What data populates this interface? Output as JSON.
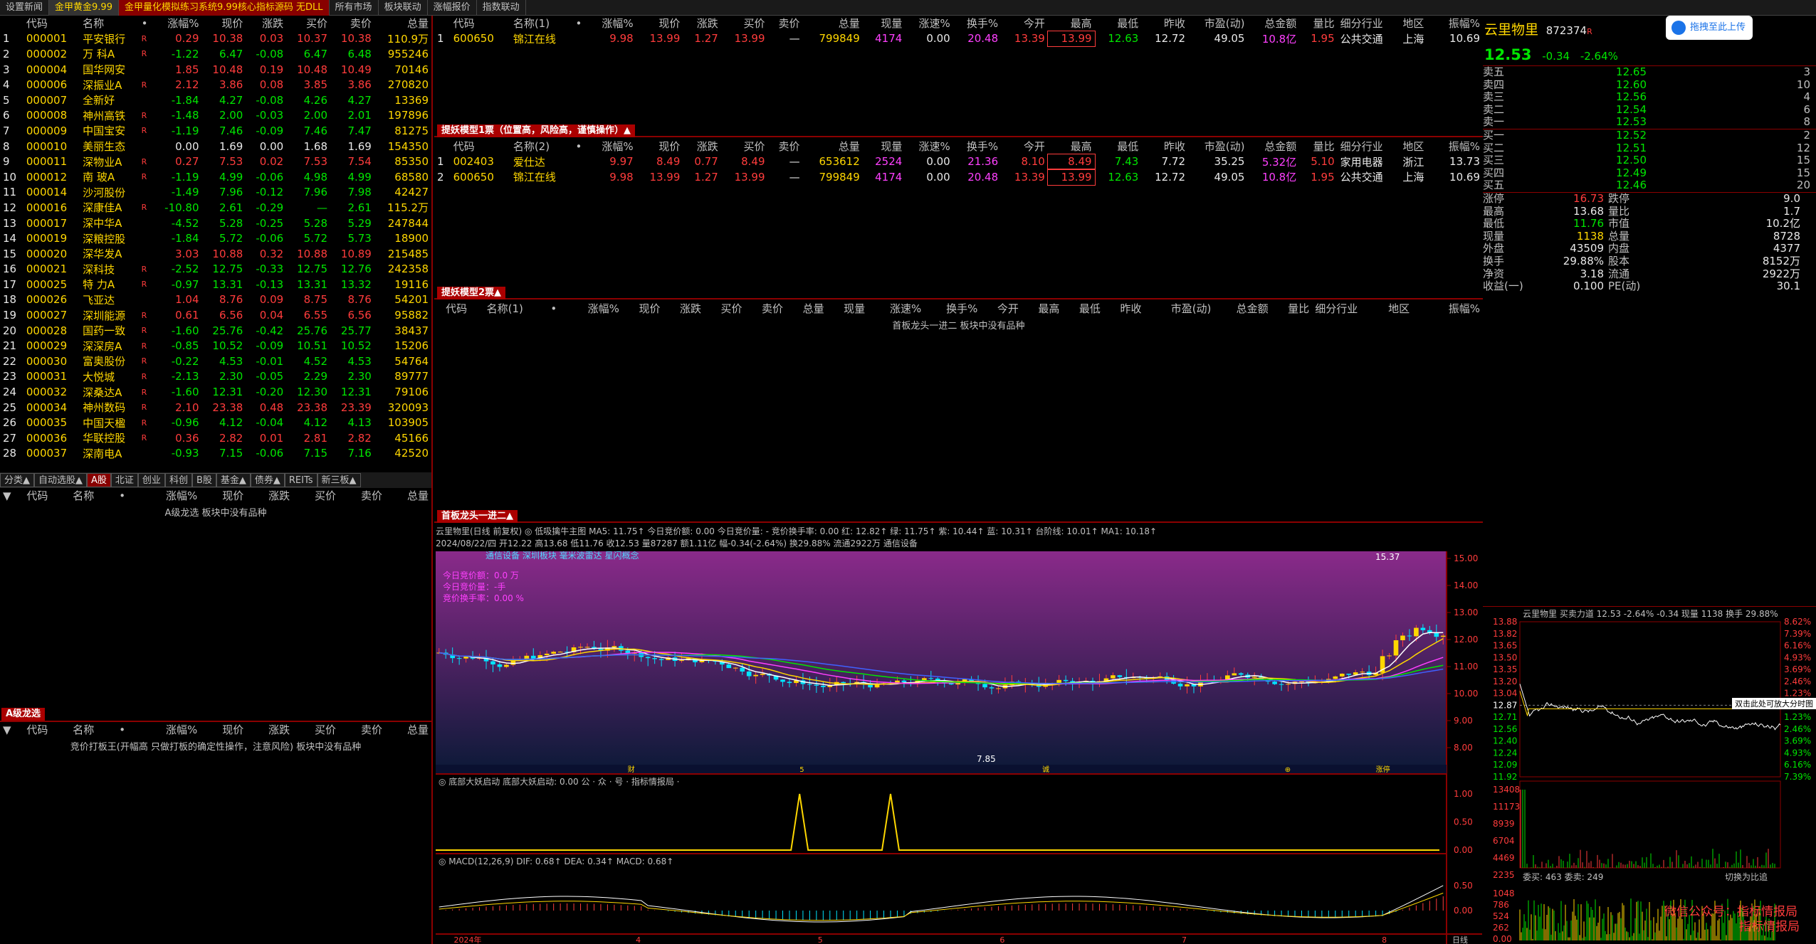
{
  "top_tabs": [
    "设置新闻",
    "金甲黄金9.99",
    "金甲量化模拟练习系统9.99核心指标源码 无DLL",
    "所有市场",
    "板块联动",
    "涨幅报价",
    "指数联动"
  ],
  "left_headers": [
    "",
    "代码",
    "名称",
    "•",
    "涨幅%",
    "现价",
    "涨跌",
    "买价",
    "卖价",
    "总量"
  ],
  "left_rows": [
    [
      "1",
      "000001",
      "平安银行",
      "R",
      "0.29",
      "10.38",
      "0.03",
      "10.37",
      "10.38",
      "110.9万"
    ],
    [
      "2",
      "000002",
      "万 科A",
      "R",
      "-1.22",
      "6.47",
      "-0.08",
      "6.47",
      "6.48",
      "955246"
    ],
    [
      "3",
      "000004",
      "国华网安",
      "",
      "1.85",
      "10.48",
      "0.19",
      "10.48",
      "10.49",
      "70146"
    ],
    [
      "4",
      "000006",
      "深振业A",
      "R",
      "2.12",
      "3.86",
      "0.08",
      "3.85",
      "3.86",
      "270820"
    ],
    [
      "5",
      "000007",
      "全新好",
      "",
      "-1.84",
      "4.27",
      "-0.08",
      "4.26",
      "4.27",
      "13369"
    ],
    [
      "6",
      "000008",
      "神州高铁",
      "R",
      "-1.48",
      "2.00",
      "-0.03",
      "2.00",
      "2.01",
      "197896"
    ],
    [
      "7",
      "000009",
      "中国宝安",
      "R",
      "-1.19",
      "7.46",
      "-0.09",
      "7.46",
      "7.47",
      "81275"
    ],
    [
      "8",
      "000010",
      "美丽生态",
      "",
      "0.00",
      "1.69",
      "0.00",
      "1.68",
      "1.69",
      "154350"
    ],
    [
      "9",
      "000011",
      "深物业A",
      "R",
      "0.27",
      "7.53",
      "0.02",
      "7.53",
      "7.54",
      "85350"
    ],
    [
      "10",
      "000012",
      "南 玻A",
      "R",
      "-1.19",
      "4.99",
      "-0.06",
      "4.98",
      "4.99",
      "68580"
    ],
    [
      "11",
      "000014",
      "沙河股份",
      "",
      "-1.49",
      "7.96",
      "-0.12",
      "7.96",
      "7.98",
      "42427"
    ],
    [
      "12",
      "000016",
      "深康佳A",
      "R",
      "-10.80",
      "2.61",
      "-0.29",
      "—",
      "2.61",
      "115.2万"
    ],
    [
      "13",
      "000017",
      "深中华A",
      "",
      "-4.52",
      "5.28",
      "-0.25",
      "5.28",
      "5.29",
      "247844"
    ],
    [
      "14",
      "000019",
      "深粮控股",
      "",
      "-1.84",
      "5.72",
      "-0.06",
      "5.72",
      "5.73",
      "18900"
    ],
    [
      "15",
      "000020",
      "深华发A",
      "",
      "3.03",
      "10.88",
      "0.32",
      "10.88",
      "10.89",
      "215485"
    ],
    [
      "16",
      "000021",
      "深科技",
      "R",
      "-2.52",
      "12.75",
      "-0.33",
      "12.75",
      "12.76",
      "242358"
    ],
    [
      "17",
      "000025",
      "特 力A",
      "R",
      "-0.97",
      "13.31",
      "-0.13",
      "13.31",
      "13.32",
      "19116"
    ],
    [
      "18",
      "000026",
      "飞亚达",
      "",
      "1.04",
      "8.76",
      "0.09",
      "8.75",
      "8.76",
      "54201"
    ],
    [
      "19",
      "000027",
      "深圳能源",
      "R",
      "0.61",
      "6.56",
      "0.04",
      "6.55",
      "6.56",
      "95882"
    ],
    [
      "20",
      "000028",
      "国药一致",
      "R",
      "-1.60",
      "25.76",
      "-0.42",
      "25.76",
      "25.77",
      "38437"
    ],
    [
      "21",
      "000029",
      "深深房A",
      "R",
      "-0.85",
      "10.52",
      "-0.09",
      "10.51",
      "10.52",
      "15206"
    ],
    [
      "22",
      "000030",
      "富奥股份",
      "R",
      "-0.22",
      "4.53",
      "-0.01",
      "4.52",
      "4.53",
      "54764"
    ],
    [
      "23",
      "000031",
      "大悦城",
      "R",
      "-2.13",
      "2.30",
      "-0.05",
      "2.29",
      "2.30",
      "89777"
    ],
    [
      "24",
      "000032",
      "深桑达A",
      "R",
      "-1.60",
      "12.31",
      "-0.20",
      "12.30",
      "12.31",
      "79106"
    ],
    [
      "25",
      "000034",
      "神州数码",
      "R",
      "2.10",
      "23.38",
      "0.48",
      "23.38",
      "23.39",
      "320093"
    ],
    [
      "26",
      "000035",
      "中国天楹",
      "R",
      "-0.96",
      "4.12",
      "-0.04",
      "4.12",
      "4.13",
      "103905"
    ],
    [
      "27",
      "000036",
      "华联控股",
      "R",
      "0.36",
      "2.82",
      "0.01",
      "2.81",
      "2.82",
      "45166"
    ],
    [
      "28",
      "000037",
      "深南电A",
      "",
      "-0.93",
      "7.15",
      "-0.06",
      "7.15",
      "7.16",
      "42520"
    ]
  ],
  "left_subtabs": [
    "分类▲",
    "自动选股▲",
    "A股",
    "北证",
    "创业",
    "科创",
    "B股",
    "基金▲",
    "债券▲",
    "REITs",
    "新三板▲"
  ],
  "left_mid_headers": [
    "代码",
    "名称",
    "•",
    "涨幅%",
    "现价",
    "涨跌",
    "买价",
    "卖价",
    "总量"
  ],
  "left_mid_msg": "A级龙选 板块中没有品种",
  "left_bottom_title": "A级龙选",
  "left_bottom_msg": "竞价打板王(开幅高 只做打板的确定性操作，注意风险) 板块中没有品种",
  "main_headers": [
    "",
    "代码",
    "名称(1)",
    "•",
    "涨幅%",
    "现价",
    "涨跌",
    "买价",
    "卖价",
    "总量",
    "现量",
    "涨速%",
    "换手%",
    "今开",
    "最高",
    "最低",
    "昨收",
    "市盈(动)",
    "总金额",
    "量比",
    "细分行业",
    "地区",
    "振幅%"
  ],
  "main_rows1": [
    [
      "1",
      "600650",
      "锦江在线",
      "",
      "9.98",
      "13.99",
      "1.27",
      "13.99",
      "—",
      "799849",
      "4174",
      "0.00",
      "20.48",
      "13.39",
      "13.99",
      "12.63",
      "12.72",
      "49.05",
      "10.8亿",
      "1.95",
      "公共交通",
      "上海",
      "10.69"
    ]
  ],
  "section2_title": "提妖模型1票（位置高，风险高，谨慎操作）▲",
  "main_headers2_name": "名称(2)",
  "main_rows2": [
    [
      "1",
      "002403",
      "爱仕达",
      "",
      "9.97",
      "8.49",
      "0.77",
      "8.49",
      "—",
      "653612",
      "2524",
      "0.00",
      "21.36",
      "8.10",
      "8.49",
      "7.43",
      "7.72",
      "35.25",
      "5.32亿",
      "5.10",
      "家用电器",
      "浙江",
      "13.73"
    ],
    [
      "2",
      "600650",
      "锦江在线",
      "",
      "9.98",
      "13.99",
      "1.27",
      "13.99",
      "—",
      "799849",
      "4174",
      "0.00",
      "20.48",
      "13.39",
      "13.99",
      "12.63",
      "12.72",
      "49.05",
      "10.8亿",
      "1.95",
      "公共交通",
      "上海",
      "10.69"
    ]
  ],
  "section3_title": "提妖模型2票▲",
  "section3_msg": "首板龙头一进二 板块中没有品种",
  "section4_title": "首板龙头一进二▲",
  "chart_info_line1": "云里物里(日线 前复权)  ◎ 低吸擒牛主图  MA5: 11.75↑  今日竞价额: 0.00  今日竞价量: -  竞价换手率: 0.00  红: 12.82↑  绿: 11.75↑  紫: 10.44↑  蓝: 10.31↑  台阶线: 10.01↑  MA1: 10.18↑",
  "chart_info_line2": "2024/08/22/四  开12.22  高13.68  低11.76  收12.53  量87287  额1.11亿  幅-0.34(-2.64%)  换29.88%  流通2922万  通信设备",
  "chart_overlay_tag": "通信设备 深圳板块 毫米波雷达 星闪概念",
  "chart_overlay_lines": [
    "今日竞价额：0.0 万",
    "今日竞价量：-手",
    "竞价换手率：0.00 %"
  ],
  "chart_ylabels": [
    "15.00",
    "14.00",
    "13.00",
    "12.00",
    "11.00",
    "10.00",
    "9.00",
    "8.00"
  ],
  "chart_high_label": "15.37",
  "chart_low_label": "7.85",
  "ind1_info": "◎ 底部大妖启动  底部大妖启动: 0.00  公 · 众 · 号 · 指标情报局 ·",
  "ind1_ylabels": [
    "1.00",
    "0.50",
    "0.00"
  ],
  "macd_info": "◎ MACD(12,26,9)  DIF: 0.68↑  DEA: 0.34↑  MACD: 0.68↑",
  "macd_ylabels": [
    "0.50",
    "0.00"
  ],
  "x_labels": [
    "2024年",
    "4",
    "5",
    "6",
    "7",
    "8"
  ],
  "x_marker_labels": [
    "财",
    "5",
    "诚",
    "⊕",
    "涨停"
  ],
  "x_axis_right": "日线",
  "rp": {
    "title": "云里物里",
    "code": "872374",
    "tag": "R",
    "price": "12.53",
    "chg": "-0.34",
    "pct": "-2.64%",
    "upload_btn": "拖拽至此上传",
    "asks": [
      [
        "卖五",
        "12.65",
        "3"
      ],
      [
        "卖四",
        "12.60",
        "10"
      ],
      [
        "卖三",
        "12.56",
        "4"
      ],
      [
        "卖二",
        "12.54",
        "6"
      ],
      [
        "卖一",
        "12.53",
        "8"
      ]
    ],
    "bids": [
      [
        "买一",
        "12.52",
        "2"
      ],
      [
        "买二",
        "12.51",
        "12"
      ],
      [
        "买三",
        "12.50",
        "15"
      ],
      [
        "买四",
        "12.49",
        "15"
      ],
      [
        "买五",
        "12.46",
        "20"
      ]
    ],
    "stats": [
      [
        "涨停",
        "16.73",
        "跌停",
        "9.0"
      ],
      [
        "最高",
        "13.68",
        "量比",
        "1.7"
      ],
      [
        "最低",
        "11.76",
        "市值",
        "10.2亿"
      ],
      [
        "现量",
        "1138",
        "总量",
        "8728"
      ],
      [
        "外盘",
        "43509",
        "内盘",
        "4377"
      ],
      [
        "换手",
        "29.88%",
        "股本",
        "8152万"
      ],
      [
        "净资",
        "3.18",
        "流通",
        "2922万"
      ],
      [
        "收益(一)",
        "0.100",
        "PE(动)",
        "30.1"
      ]
    ],
    "mini_header": "云里物里  买卖力道  12.53 -2.64%  -0.34  现量 1138  换手 29.88%",
    "mini_left": [
      "13.88",
      "13.82",
      "13.65",
      "13.50",
      "13.35",
      "13.20",
      "13.04",
      "12.87",
      "12.71",
      "12.56",
      "12.40",
      "12.24",
      "12.09",
      "11.92"
    ],
    "mini_right": [
      "8.62%",
      "7.39%",
      "6.16%",
      "4.93%",
      "3.69%",
      "2.46%",
      "1.23%",
      "0.00%",
      "1.23%",
      "2.46%",
      "3.69%",
      "4.93%",
      "6.16%",
      "7.39%"
    ],
    "vol_left": [
      "13408",
      "11173",
      "8939",
      "6704",
      "4469",
      "2235"
    ],
    "tooltip": "双击此处可放大分时图",
    "wei": "委买: 463  委卖: 249",
    "switch": "切换为比追",
    "bottom_left": [
      "1048",
      "786",
      "524",
      "262",
      "0.00"
    ],
    "watermark1": "微信公众号：指标情报局",
    "watermark2": "指标情报局"
  },
  "colors": {
    "up": "#ff3c3c",
    "down": "#00e600",
    "accent": "#a00000",
    "bg": "#000000"
  }
}
